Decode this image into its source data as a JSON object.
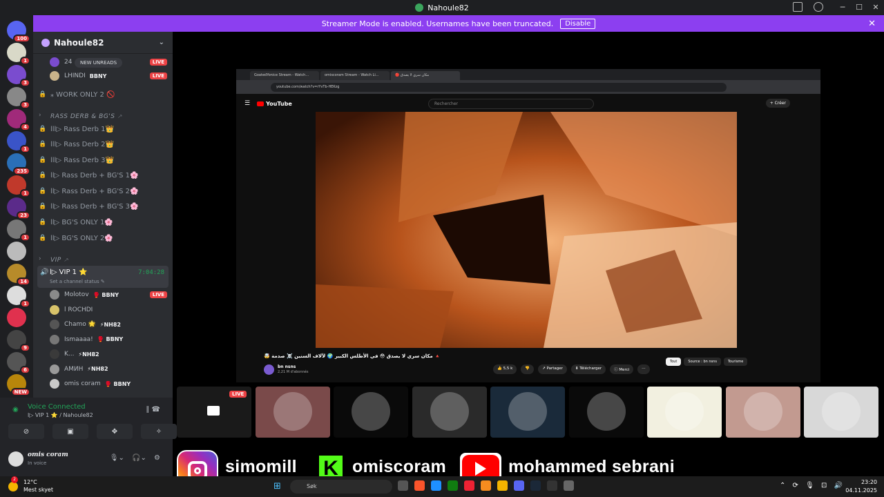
{
  "window": {
    "title": "Nahoule82"
  },
  "banner": {
    "text": "Streamer Mode is enabled. Usernames have been truncated.",
    "button": "Disable"
  },
  "servers": [
    {
      "badge": "100",
      "color": "#5865f2"
    },
    {
      "badge": "1",
      "color": "#d9d9c8"
    },
    {
      "badge": "3",
      "color": "#7a4ccf"
    },
    {
      "badge": "3",
      "color": "#888"
    },
    {
      "badge": "4",
      "color": "#a02a7a"
    },
    {
      "badge": "1",
      "color": "#3a54c8"
    },
    {
      "badge": "235",
      "color": "#2a6fb7"
    },
    {
      "badge": "1",
      "color": "#c0392b"
    },
    {
      "badge": "23",
      "color": "#5b2b8a"
    },
    {
      "badge": "1",
      "color": "#777"
    },
    {
      "badge": "",
      "color": "#bbb"
    },
    {
      "badge": "14",
      "color": "#b78b2a"
    },
    {
      "badge": "1",
      "color": "#ddd"
    },
    {
      "badge": "",
      "color": "#e0314e"
    },
    {
      "badge": "9",
      "color": "#444"
    },
    {
      "badge": "6",
      "color": "#555"
    },
    {
      "badge": "NEW",
      "color": "#b8860b"
    }
  ],
  "guild": {
    "name": "Nahoule82"
  },
  "new_unreads": "NEW UNREADS",
  "top_voice": [
    {
      "name": "24",
      "tag": "BBNY",
      "live": "LIVE"
    },
    {
      "name": "LHINDI",
      "tag": "BBNY",
      "live": "LIVE"
    }
  ],
  "channels": [
    {
      "label": "⁎ WORK ONLY 2 🚫",
      "kind": "locked"
    },
    {
      "label": "RASS DERB & BG'S ⸕",
      "kind": "category"
    },
    {
      "label": "lll▷ Rass Derb 1👑",
      "kind": "locked"
    },
    {
      "label": "lll▷ Rass Derb 2👑",
      "kind": "locked"
    },
    {
      "label": "lll▷ Rass Derb 3👑",
      "kind": "locked"
    },
    {
      "label": "ll▷ Rass Derb + BG'S 1🌸",
      "kind": "locked"
    },
    {
      "label": "ll▷ Rass Derb + BG'S 2🌸",
      "kind": "locked"
    },
    {
      "label": "ll▷ Rass Derb + BG'S 3🌸",
      "kind": "locked"
    },
    {
      "label": "ll▷ BG'S ONLY 1🌸",
      "kind": "locked"
    },
    {
      "label": "ll▷ BG'S ONLY 2🌸",
      "kind": "locked"
    },
    {
      "label": "VIP ⸕",
      "kind": "category"
    }
  ],
  "vip": {
    "name": "l▷ VIP 1 ⭐",
    "timer": "7:04:28",
    "status": "Set a channel status ✎"
  },
  "vip_members": [
    {
      "name": "Molotov",
      "tag": "🥊 BBNY",
      "live": "LIVE",
      "color": "#8a8a8a"
    },
    {
      "name": "l ROCHDI",
      "tag": "",
      "live": "",
      "color": "#d8c36a"
    },
    {
      "name": "Chamo 🌟",
      "tag": "⚡NH82",
      "live": "",
      "color": "#555"
    },
    {
      "name": "Ismaaaa!",
      "tag": "🥊 BBNY",
      "live": "",
      "color": "#777"
    },
    {
      "name": "K...",
      "tag": "⚡NH82",
      "live": "",
      "color": "#3a3a3a"
    },
    {
      "name": "AMИH",
      "tag": "⚡NH82",
      "live": "",
      "color": "#999"
    },
    {
      "name": "omis coram",
      "tag": "🥊 BBNY",
      "live": "",
      "color": "#c9c9c9"
    }
  ],
  "voice": {
    "status": "Voice Connected",
    "channel": "l▷ VIP 1 ⭐ / Nahoule82"
  },
  "user": {
    "name": "omis coram",
    "status": "In voice"
  },
  "browser": {
    "tabs": [
      "GoatedYonice Stream - Watch...",
      "omiscoram Stream - Watch Li...",
      "🔴 مكان سري لا يصدق"
    ],
    "url": "youtube.com/watch?v=rYvTb-HEKzg",
    "search": "Rechercher",
    "logo": "YouTube",
    "create": "+ Créer",
    "title": "🤯 مكان سري لا يصدق 😳 في الأطلس الكبير 🌍 لآلاف السنين ☠️ صدمة 🔺",
    "channel": "bn nsns",
    "subs": "2,21 M d'abonnés",
    "actions": [
      "👍 5,5 k",
      "👎",
      "↗ Partager",
      "⬇ Télécharger",
      "ⓘ Merci",
      "⋯"
    ],
    "chips": [
      "Tout",
      "Source : bn nsns",
      "Tourisme"
    ]
  },
  "tiles": [
    {
      "name": "stream-screen",
      "bg": "#1a1a1a",
      "live": "LIVE"
    },
    {
      "name": "avatar-tile",
      "bg": "#7a4a4a",
      "live": ""
    },
    {
      "name": "avatar-tile",
      "bg": "#0a0a0a",
      "live": ""
    },
    {
      "name": "avatar-tile",
      "bg": "#2a2a2a",
      "live": ""
    },
    {
      "name": "avatar-tile",
      "bg": "#1a2a3a",
      "live": ""
    },
    {
      "name": "avatar-tile",
      "bg": "#0a0a0a",
      "live": ""
    },
    {
      "name": "avatar-tile",
      "bg": "#f2f0e0",
      "live": ""
    },
    {
      "name": "avatar-tile",
      "bg": "#c29a90",
      "live": ""
    },
    {
      "name": "avatar-tile",
      "bg": "#d8d8d8",
      "live": ""
    }
  ],
  "overlay": {
    "instagram": "simomill",
    "kick": "omiscoram",
    "youtube": "mohammed sebrani",
    "kick_letter": "K"
  },
  "taskbar": {
    "temp": "12°C",
    "weather": "Mest skyet",
    "search": "Søk",
    "time": "23:20",
    "date": "04.11.2025",
    "weather_badge": "2"
  }
}
